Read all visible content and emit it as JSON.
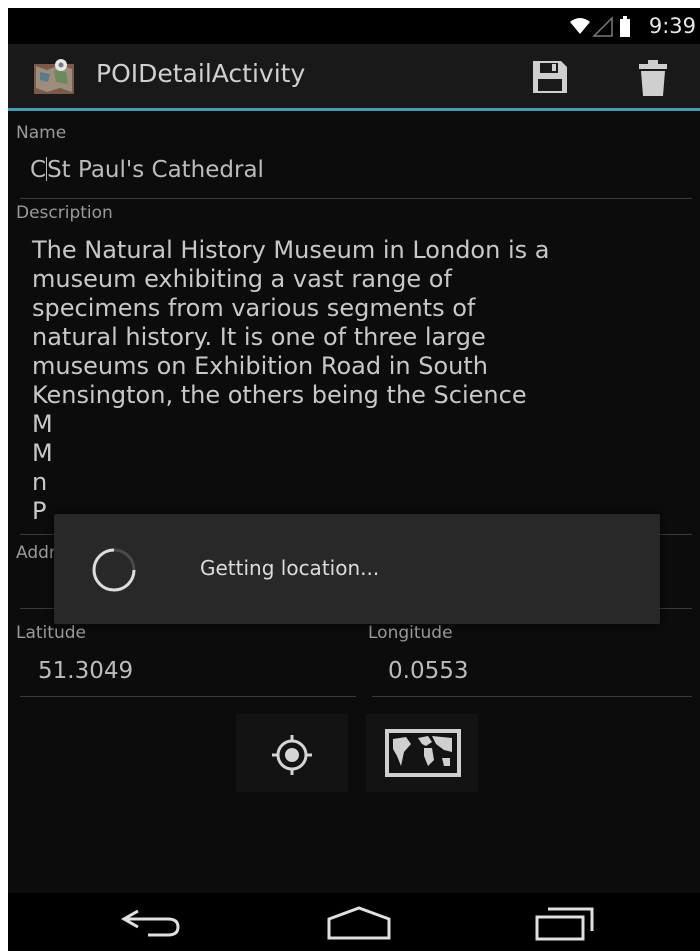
{
  "status_bar": {
    "time": "9:39",
    "icons": [
      "wifi-icon",
      "signal-icon",
      "battery-icon"
    ]
  },
  "action_bar": {
    "title": "POIDetailActivity",
    "actions": [
      "save-icon",
      "delete-icon"
    ]
  },
  "form": {
    "name_label": "Name",
    "name_value": "St Paul's Cathedral",
    "name_prefix": "C",
    "description_label": "Description",
    "description_lines": [
      "The Natural History Museum in London is a",
      "museum exhibiting a vast range of",
      "specimens from various segments of",
      "natural history. It is one of three large",
      "museums on Exhibition Road in South",
      "Kensington, the others being the Science",
      "M",
      "M",
      "n",
      "P"
    ],
    "address_label": "Address",
    "address_value": "",
    "latitude_label": "Latitude",
    "latitude_value": "51.3049",
    "longitude_label": "Longitude",
    "longitude_value": "0.0553"
  },
  "tools": [
    "locate-icon",
    "map-icon"
  ],
  "dialog": {
    "message": "Getting location..."
  },
  "nav_bar": [
    "back-icon",
    "home-icon",
    "recents-icon"
  ],
  "colors": {
    "accent": "#4a9bb1",
    "background": "#0c0c0c"
  }
}
